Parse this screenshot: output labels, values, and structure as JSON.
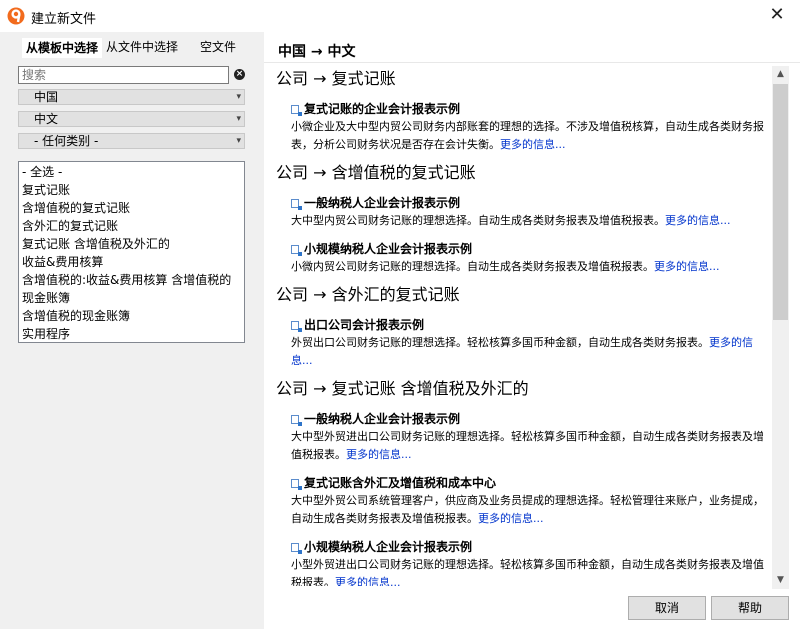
{
  "window": {
    "title": "建立新文件"
  },
  "left": {
    "tabs": [
      "从模板中选择",
      "从文件中选择",
      "空文件"
    ],
    "search_placeholder": "搜索",
    "dropdowns": [
      "中国",
      "中文",
      "- 任何类别 -"
    ],
    "categories": [
      "- 全选 -",
      "复式记账",
      "含增值税的复式记账",
      "含外汇的复式记账",
      "复式记账 含增值税及外汇的",
      "收益&费用核算",
      "含增值税的:收益&费用核算 含增值税的",
      "现金账簿",
      "含增值税的现金账簿",
      "实用程序"
    ]
  },
  "right": {
    "path": "中国 → 中文",
    "sections": [
      {
        "heading": "公司 → 复式记账",
        "entries": [
          {
            "title": "复式记账的企业会计报表示例",
            "desc": "小微企业及大中型内贸公司财务内部账套的理想的选择。不涉及增值税核算，自动生成各类财务报表，分析公司财务状况是否存在会计失衡。",
            "more": "更多的信息..."
          }
        ]
      },
      {
        "heading": "公司 → 含增值税的复式记账",
        "entries": [
          {
            "title": "一般纳税人企业会计报表示例",
            "desc": "大中型内贸公司财务记账的理想选择。自动生成各类财务报表及增值税报表。",
            "more": "更多的信息..."
          },
          {
            "title": "小规模纳税人企业会计报表示例",
            "desc": "小微内贸公司财务记账的理想选择。自动生成各类财务报表及增值税报表。",
            "more": "更多的信息..."
          }
        ]
      },
      {
        "heading": "公司 → 含外汇的复式记账",
        "entries": [
          {
            "title": "出口公司会计报表示例",
            "desc": "外贸出口公司财务记账的理想选择。轻松核算多国币种金额，自动生成各类财务报表。",
            "more": "更多的信息..."
          }
        ]
      },
      {
        "heading": "公司 → 复式记账 含增值税及外汇的",
        "entries": [
          {
            "title": "一般纳税人企业会计报表示例",
            "desc": "大中型外贸进出口公司财务记账的理想选择。轻松核算多国币种金额，自动生成各类财务报表及增值税报表。",
            "more": "更多的信息..."
          },
          {
            "title": "复式记账含外汇及增值税和成本中心",
            "desc": "大中型外贸公司系统管理客户，供应商及业务员提成的理想选择。轻松管理往来账户，业务提成，自动生成各类财务报表及增值税报表。",
            "more": "更多的信息..."
          },
          {
            "title": "小规模纳税人企业会计报表示例",
            "desc": "小型外贸进出口公司财务记账的理想选择。轻松核算多国币种金额，自动生成各类财务报表及增值税报表。",
            "more": "更多的信息..."
          }
        ]
      }
    ]
  },
  "buttons": {
    "cancel": "取消",
    "help": "帮助"
  },
  "colors": {
    "link": "#0033cc",
    "left_panel_bg": "#f0f0f0",
    "app_icon_orange": "#f26b1d"
  }
}
